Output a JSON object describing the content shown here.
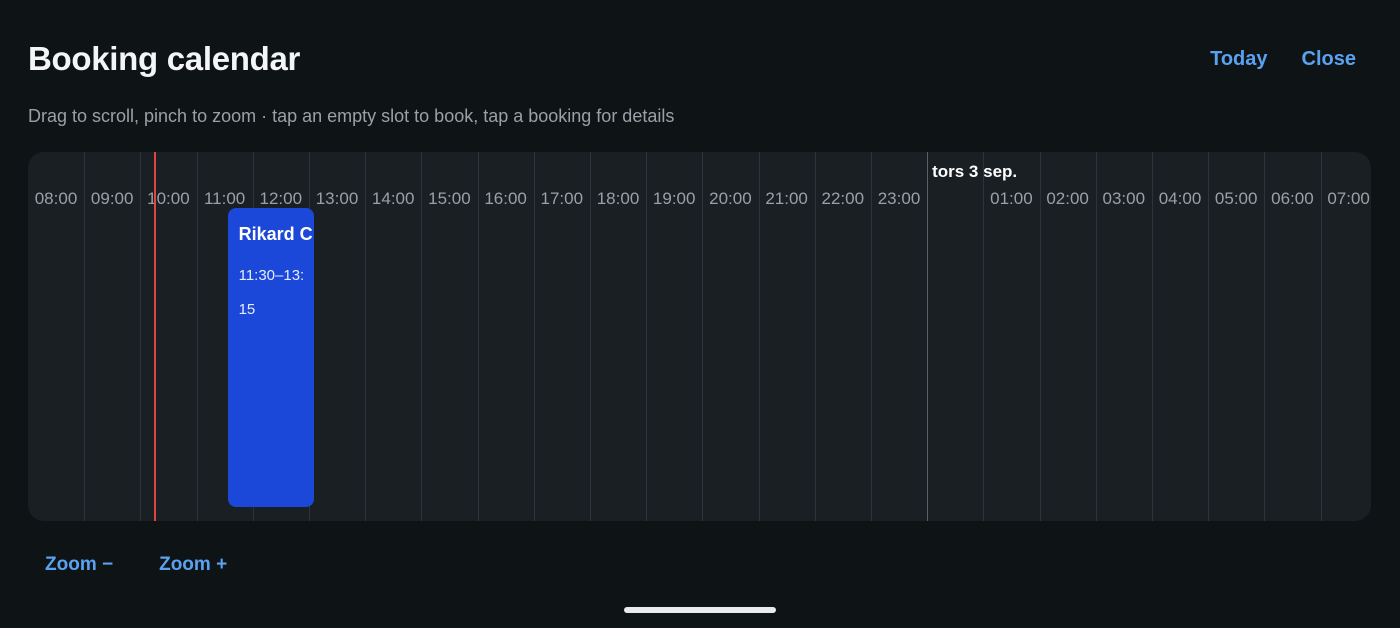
{
  "header": {
    "title": "Booking calendar",
    "today_label": "Today",
    "close_label": "Close"
  },
  "subtitle": "Drag to scroll, pinch to zoom · tap an empty slot to book, tap a booking for details",
  "timeline": {
    "hours": [
      "08:00",
      "09:00",
      "10:00",
      "11:00",
      "12:00",
      "13:00",
      "14:00",
      "15:00",
      "16:00",
      "17:00",
      "18:00",
      "19:00",
      "20:00",
      "21:00",
      "22:00",
      "23:00",
      "",
      "01:00",
      "02:00",
      "03:00",
      "04:00",
      "05:00",
      "06:00",
      "07:00"
    ],
    "day_label": "tors 3 sep.",
    "day_boundary_hour": "00:00",
    "now_time": "10:00",
    "bookings": [
      {
        "name": "Rikard C",
        "time": "11:30–13:15",
        "start": "11:30",
        "end": "13:15"
      }
    ]
  },
  "zoom": {
    "zoom_out_label": "Zoom −",
    "zoom_in_label": "Zoom +"
  },
  "colors": {
    "background": "#0e1316",
    "accent": "#5aa2f0",
    "booking": "#1b48d8",
    "now_line": "#e2453f"
  }
}
